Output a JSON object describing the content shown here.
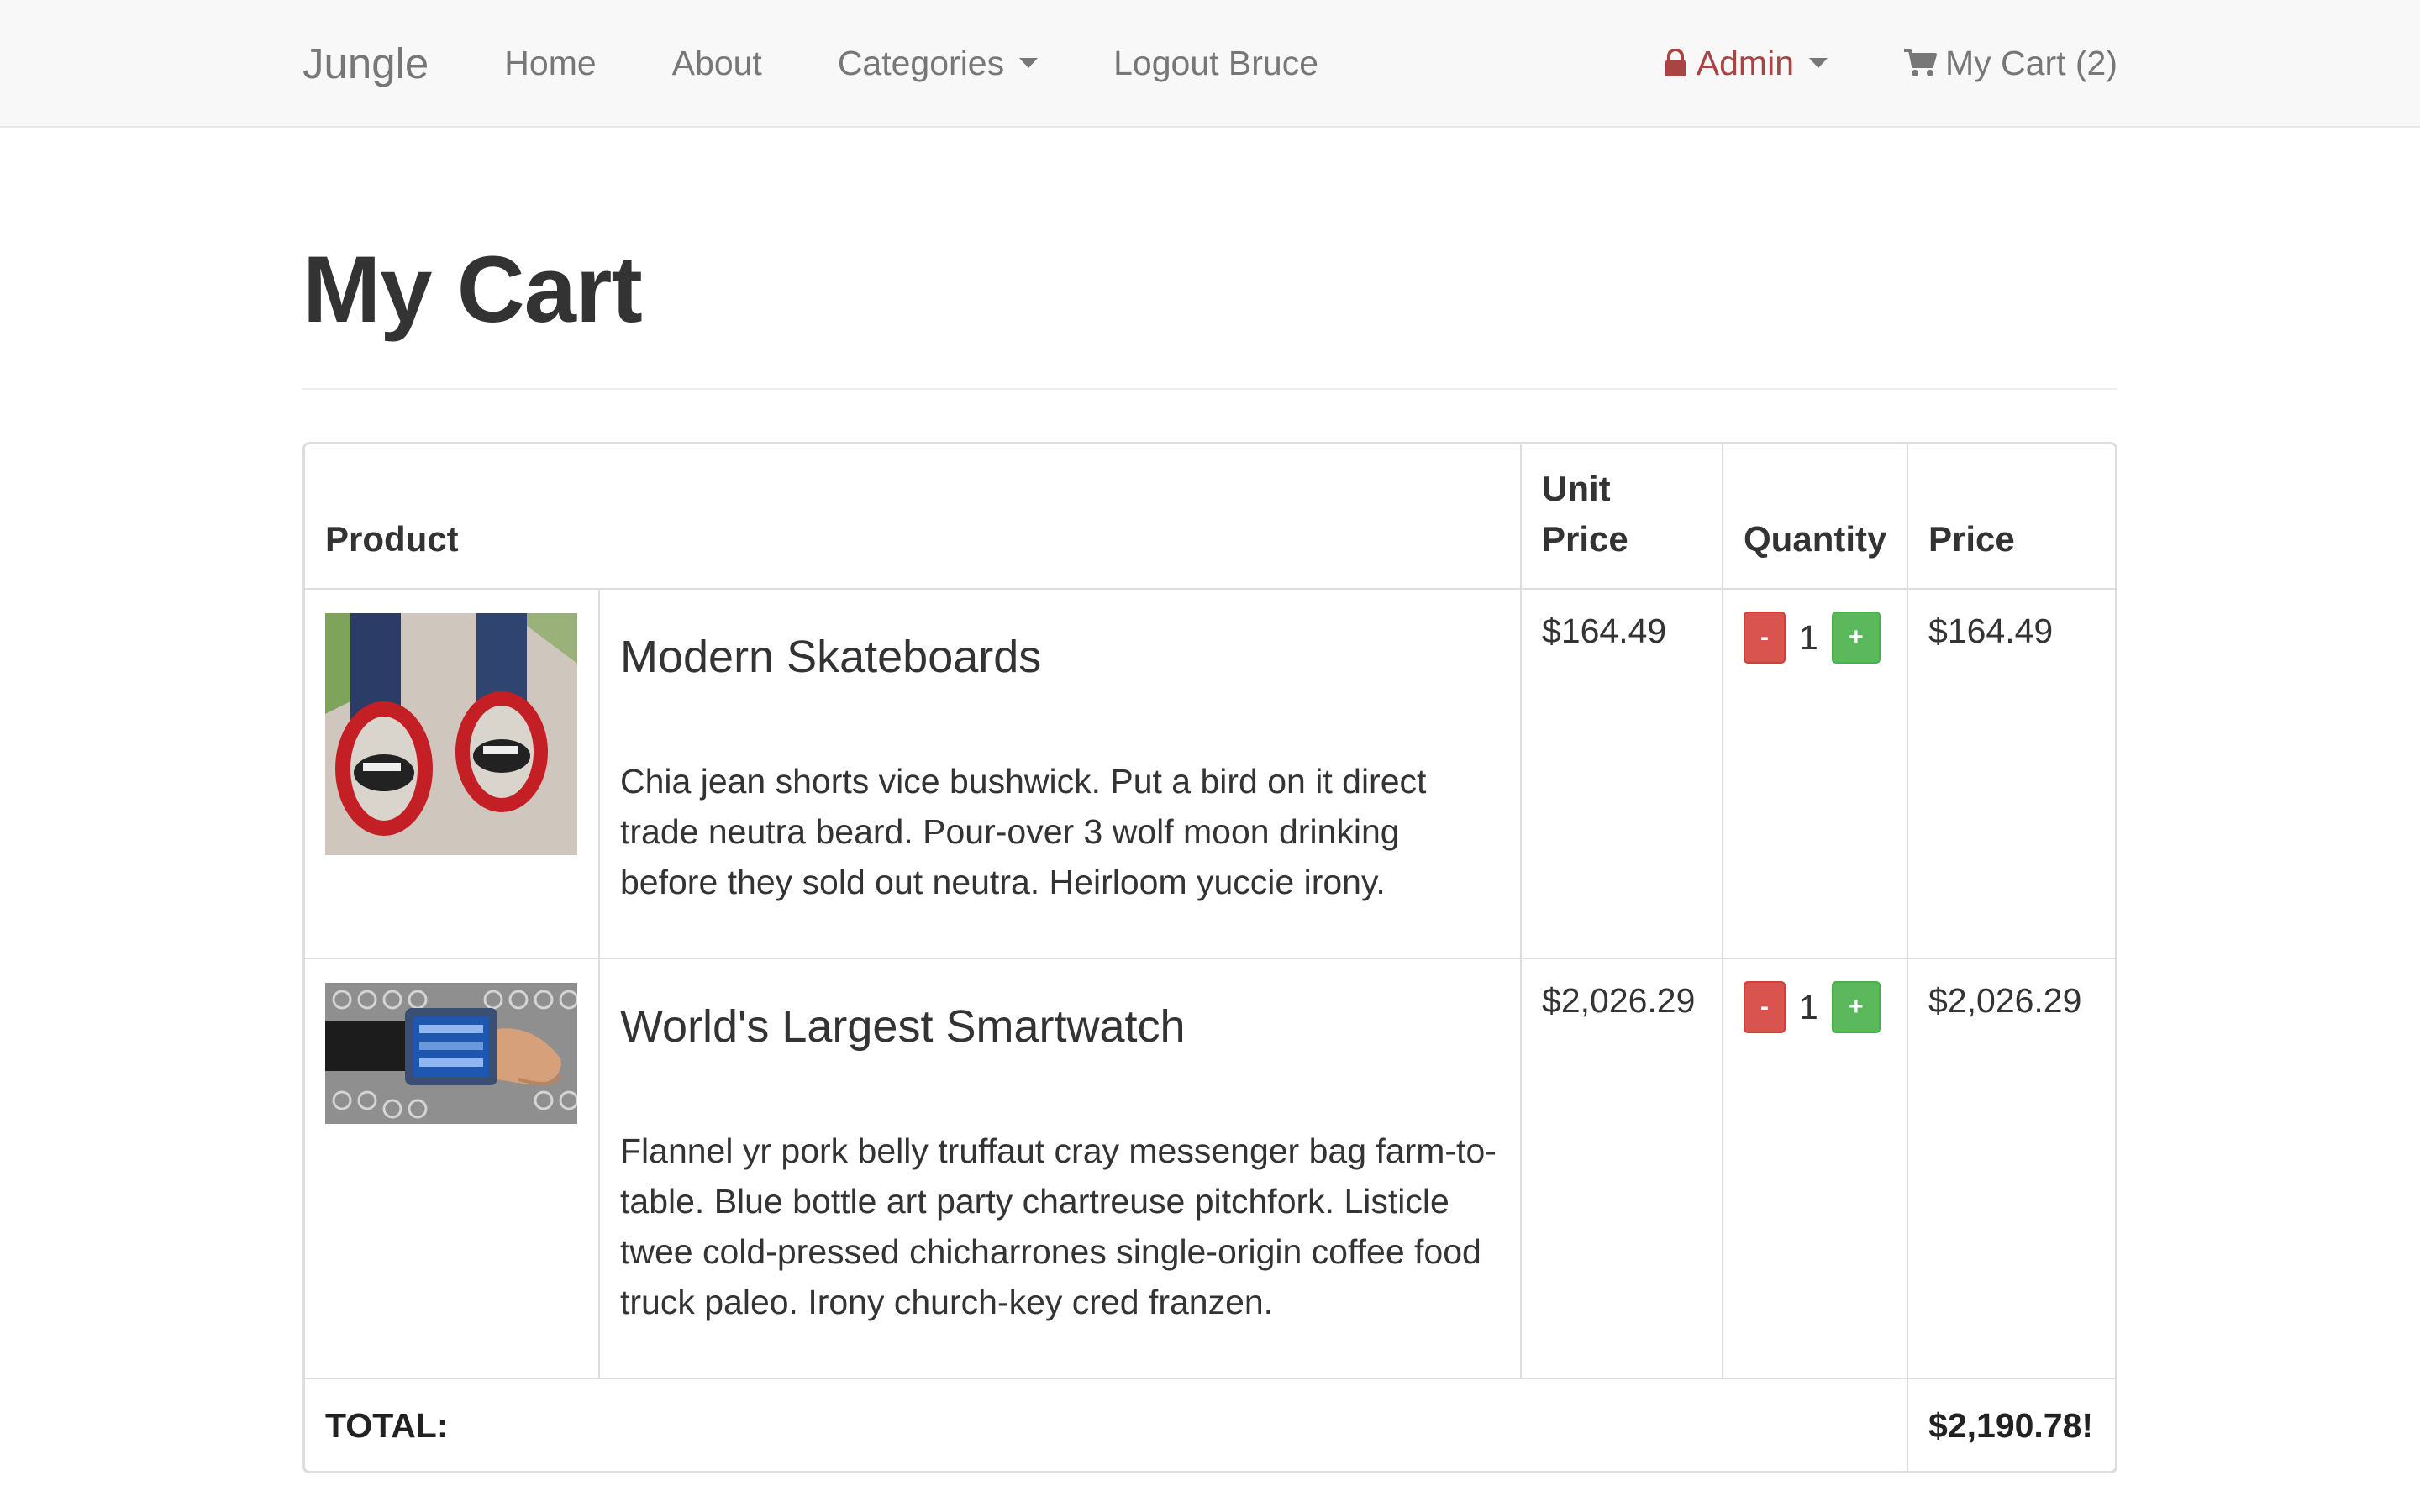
{
  "navbar": {
    "brand": "Jungle",
    "links": [
      "Home",
      "About",
      "Categories",
      "Logout Bruce"
    ],
    "admin_label": "Admin",
    "cart_label": "My Cart (2)",
    "admin_color": "#a94442"
  },
  "page": {
    "title": "My Cart"
  },
  "table": {
    "headers": {
      "product": "Product",
      "unit_price_line1": "Unit",
      "unit_price_line2": "Price",
      "quantity": "Quantity",
      "price": "Price"
    },
    "items": [
      {
        "name": "Modern Skateboards",
        "description": "Chia jean shorts vice bushwick. Put a bird on it direct trade neutra beard. Pour-over 3 wolf moon drinking before they sold out neutra. Heirloom yuccie irony.",
        "unit_price": "$164.49",
        "quantity": "1",
        "price": "$164.49",
        "minus_label": "-",
        "plus_label": "+"
      },
      {
        "name": "World's Largest Smartwatch",
        "description": "Flannel yr pork belly truffaut cray messenger bag farm-to-table. Blue bottle art party chartreuse pitchfork. Listicle twee cold-pressed chicharrones single-origin coffee food truck paleo. Irony church-key cred franzen.",
        "unit_price": "$2,026.29",
        "quantity": "1",
        "price": "$2,026.29",
        "minus_label": "-",
        "plus_label": "+"
      }
    ],
    "total_label": "TOTAL:",
    "total_value": "$2,190.78!"
  }
}
